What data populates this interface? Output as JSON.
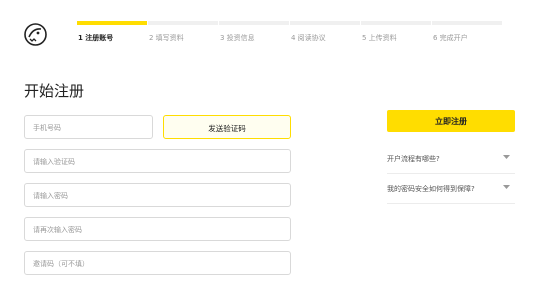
{
  "brand": {
    "logo_icon": "panda-logo-icon"
  },
  "steps": [
    {
      "label": "1 注册账号",
      "active": true
    },
    {
      "label": "2 填写资料",
      "active": false
    },
    {
      "label": "3 投资信息",
      "active": false
    },
    {
      "label": "4 阅读协议",
      "active": false
    },
    {
      "label": "5 上传资料",
      "active": false
    },
    {
      "label": "6 完成开户",
      "active": false
    }
  ],
  "form": {
    "title": "开始注册",
    "phone_placeholder": "手机号码",
    "send_code_label": "发送验证码",
    "code_placeholder": "请输入验证码",
    "password_placeholder": "请输入密码",
    "confirm_password_placeholder": "请再次输入密码",
    "invite_placeholder": "邀请码（可不填）"
  },
  "side": {
    "register_label": "立即注册",
    "faq": [
      {
        "question": "开户流程有哪些?"
      },
      {
        "question": "我的密码安全如何得到保障?"
      }
    ]
  },
  "colors": {
    "accent": "#ffdd00",
    "border": "#d9d9d9",
    "muted": "#999999"
  }
}
